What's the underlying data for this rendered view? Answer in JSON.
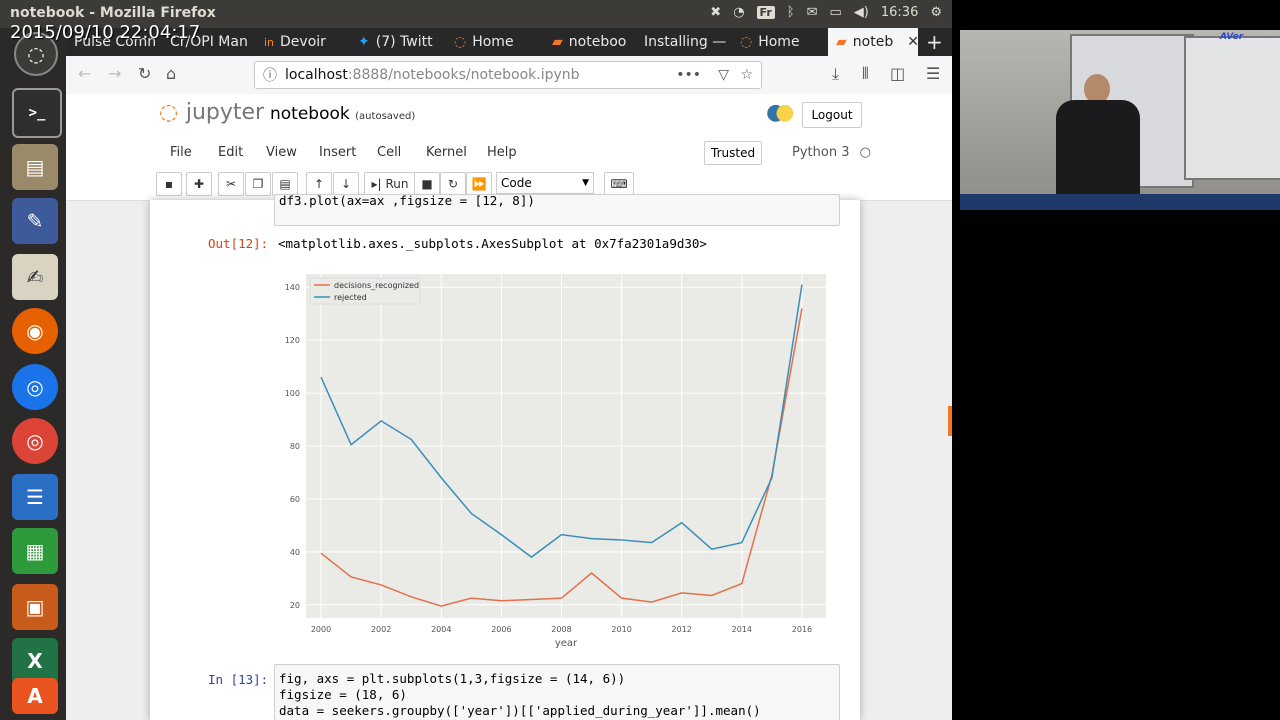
{
  "top_panel": {
    "window_title": "notebook - Mozilla Firefox",
    "keyboard_layout": "Fr",
    "time": "16:36"
  },
  "overlay_timestamp": "2015/09/10 22:04:17",
  "browser": {
    "tabs": [
      {
        "label": "Pulse Comn"
      },
      {
        "label": "Cr/OPI Man"
      },
      {
        "label": "Devoir"
      },
      {
        "label": "(7) Twitt"
      },
      {
        "label": "Home"
      },
      {
        "label": "noteboo"
      },
      {
        "label": "Installing —"
      },
      {
        "label": "Home"
      },
      {
        "label": "noteb",
        "active": true
      }
    ],
    "url_host": "localhost",
    "url_path": ":8888/notebooks/notebook.ipynb"
  },
  "jupyter": {
    "logo_text": "jupyter",
    "notebook_name": "notebook",
    "autosave_status": "(autosaved)",
    "logout_label": "Logout",
    "menu": [
      "File",
      "Edit",
      "View",
      "Insert",
      "Cell",
      "Kernel",
      "Help"
    ],
    "trusted_label": "Trusted",
    "kernel_name": "Python 3",
    "run_label": "Run",
    "cell_type": "Code"
  },
  "cells": {
    "prev_code_tail": "df3.plot(ax=ax ,figsize = [12, 8])",
    "out_prompt": "Out[12]:",
    "out_text": "<matplotlib.axes._subplots.AxesSubplot at 0x7fa2301a9d30>",
    "in_prompt": "In [13]:",
    "next_code": [
      "fig, axs = plt.subplots(1,3,figsize = (14, 6))",
      "figsize = (18, 6)",
      "data = seekers.groupby(['year'])[['applied_during_year']].mean()"
    ]
  },
  "chart_data": {
    "type": "line",
    "xlabel": "year",
    "ylabel": "",
    "xlim": [
      1999.5,
      2016.8
    ],
    "ylim": [
      15,
      145
    ],
    "xticks": [
      2000,
      2002,
      2004,
      2006,
      2008,
      2010,
      2012,
      2014,
      2016
    ],
    "yticks": [
      20,
      40,
      60,
      80,
      100,
      120,
      140
    ],
    "legend_position": "top-left",
    "grid": true,
    "x": [
      2000,
      2001,
      2002,
      2003,
      2004,
      2005,
      2006,
      2007,
      2008,
      2009,
      2010,
      2011,
      2012,
      2013,
      2014,
      2015,
      2016
    ],
    "series": [
      {
        "name": "decisions_recognized",
        "color": "#e2714b",
        "values": [
          39.5,
          30.5,
          27.5,
          23,
          19.5,
          22.5,
          21.5,
          22,
          22.5,
          32,
          22.5,
          21,
          24.5,
          23.5,
          28,
          69,
          132
        ]
      },
      {
        "name": "rejected",
        "color": "#3a8fb7",
        "values": [
          106,
          80.5,
          89.5,
          82.5,
          68,
          54.5,
          46.5,
          38,
          46.5,
          45,
          44.5,
          43.5,
          51,
          41,
          43.5,
          68,
          141
        ]
      }
    ]
  }
}
